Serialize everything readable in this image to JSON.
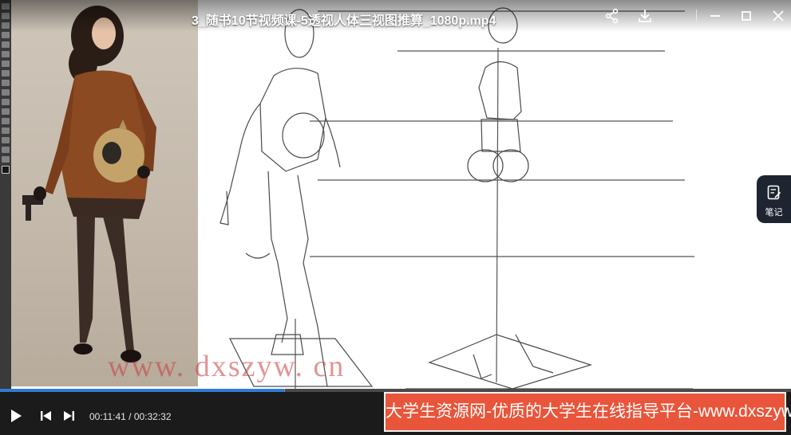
{
  "window": {
    "title": "3_随书10节视频课-5透视人体三视图推算_1080p.mp4"
  },
  "titlebar_icons": {
    "share": "share-icon",
    "download": "download-icon",
    "minimize": "minimize-icon",
    "maximize": "maximize-icon",
    "close": "close-icon"
  },
  "watermark": {
    "text": "www. dxszyw. cn"
  },
  "notes_button": {
    "label": "笔记"
  },
  "player": {
    "current_time": "00:11:41",
    "total_time": "00:32:32",
    "time_display": "00:11:41 / 00:32:32",
    "progress": 0.359,
    "accent_color": "#2f7bd6"
  },
  "ad_banner": {
    "text": "大学生资源网-优质的大学生在线指导平台-www.dxszyw.cn",
    "background_color": "#e8553a"
  }
}
